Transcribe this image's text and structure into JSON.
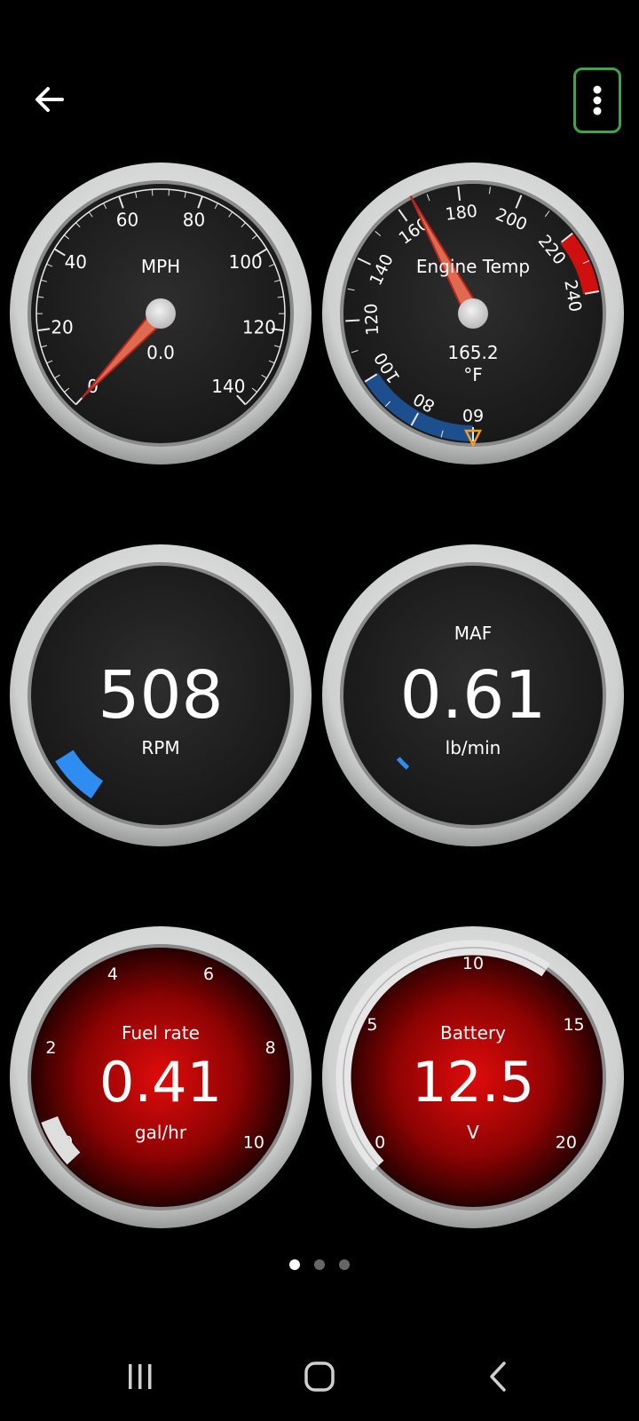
{
  "gauges": {
    "mph": {
      "title": "MPH",
      "value": "0.0",
      "needle_value": 0,
      "ticks": [
        "0",
        "20",
        "40",
        "60",
        "80",
        "100",
        "120",
        "140"
      ]
    },
    "engine_temp": {
      "title": "Engine Temp",
      "value": "165.2",
      "unit": "°F",
      "needle_value": 165.2,
      "ticks": [
        "60",
        "80",
        "100",
        "120",
        "140",
        "160",
        "180",
        "200",
        "220",
        "240"
      ],
      "cold_zone": [
        60,
        100
      ],
      "hot_zone": [
        220,
        240
      ],
      "marker_value": 60
    },
    "rpm": {
      "value": "508",
      "unit": "RPM",
      "bar_color": "#2f8cf0"
    },
    "maf": {
      "title": "MAF",
      "value": "0.61",
      "unit": "lb/min",
      "bar_color": "#2f8cf0"
    },
    "fuel_rate": {
      "title": "Fuel rate",
      "value": "0.41",
      "unit": "gal/hr",
      "ticks": [
        "0",
        "2",
        "4",
        "6",
        "8",
        "10"
      ],
      "level": 0.41
    },
    "battery": {
      "title": "Battery",
      "value": "12.5",
      "unit": "V",
      "ticks": [
        "0",
        "5",
        "10",
        "15",
        "20"
      ],
      "level": 12.5
    }
  },
  "pager": {
    "pages": 3,
    "active": 0
  },
  "colors": {
    "accent_green": "#3fa34d",
    "needle_red": "#d8372b",
    "cold_blue": "#1d4f8e",
    "hot_red": "#d01010",
    "marker_orange": "#f0a020"
  },
  "icons": {
    "back": "arrow-left-icon",
    "menu": "more-vertical-icon",
    "nav_recent": "recent-apps-icon",
    "nav_home": "home-icon",
    "nav_back": "back-chevron-icon"
  }
}
